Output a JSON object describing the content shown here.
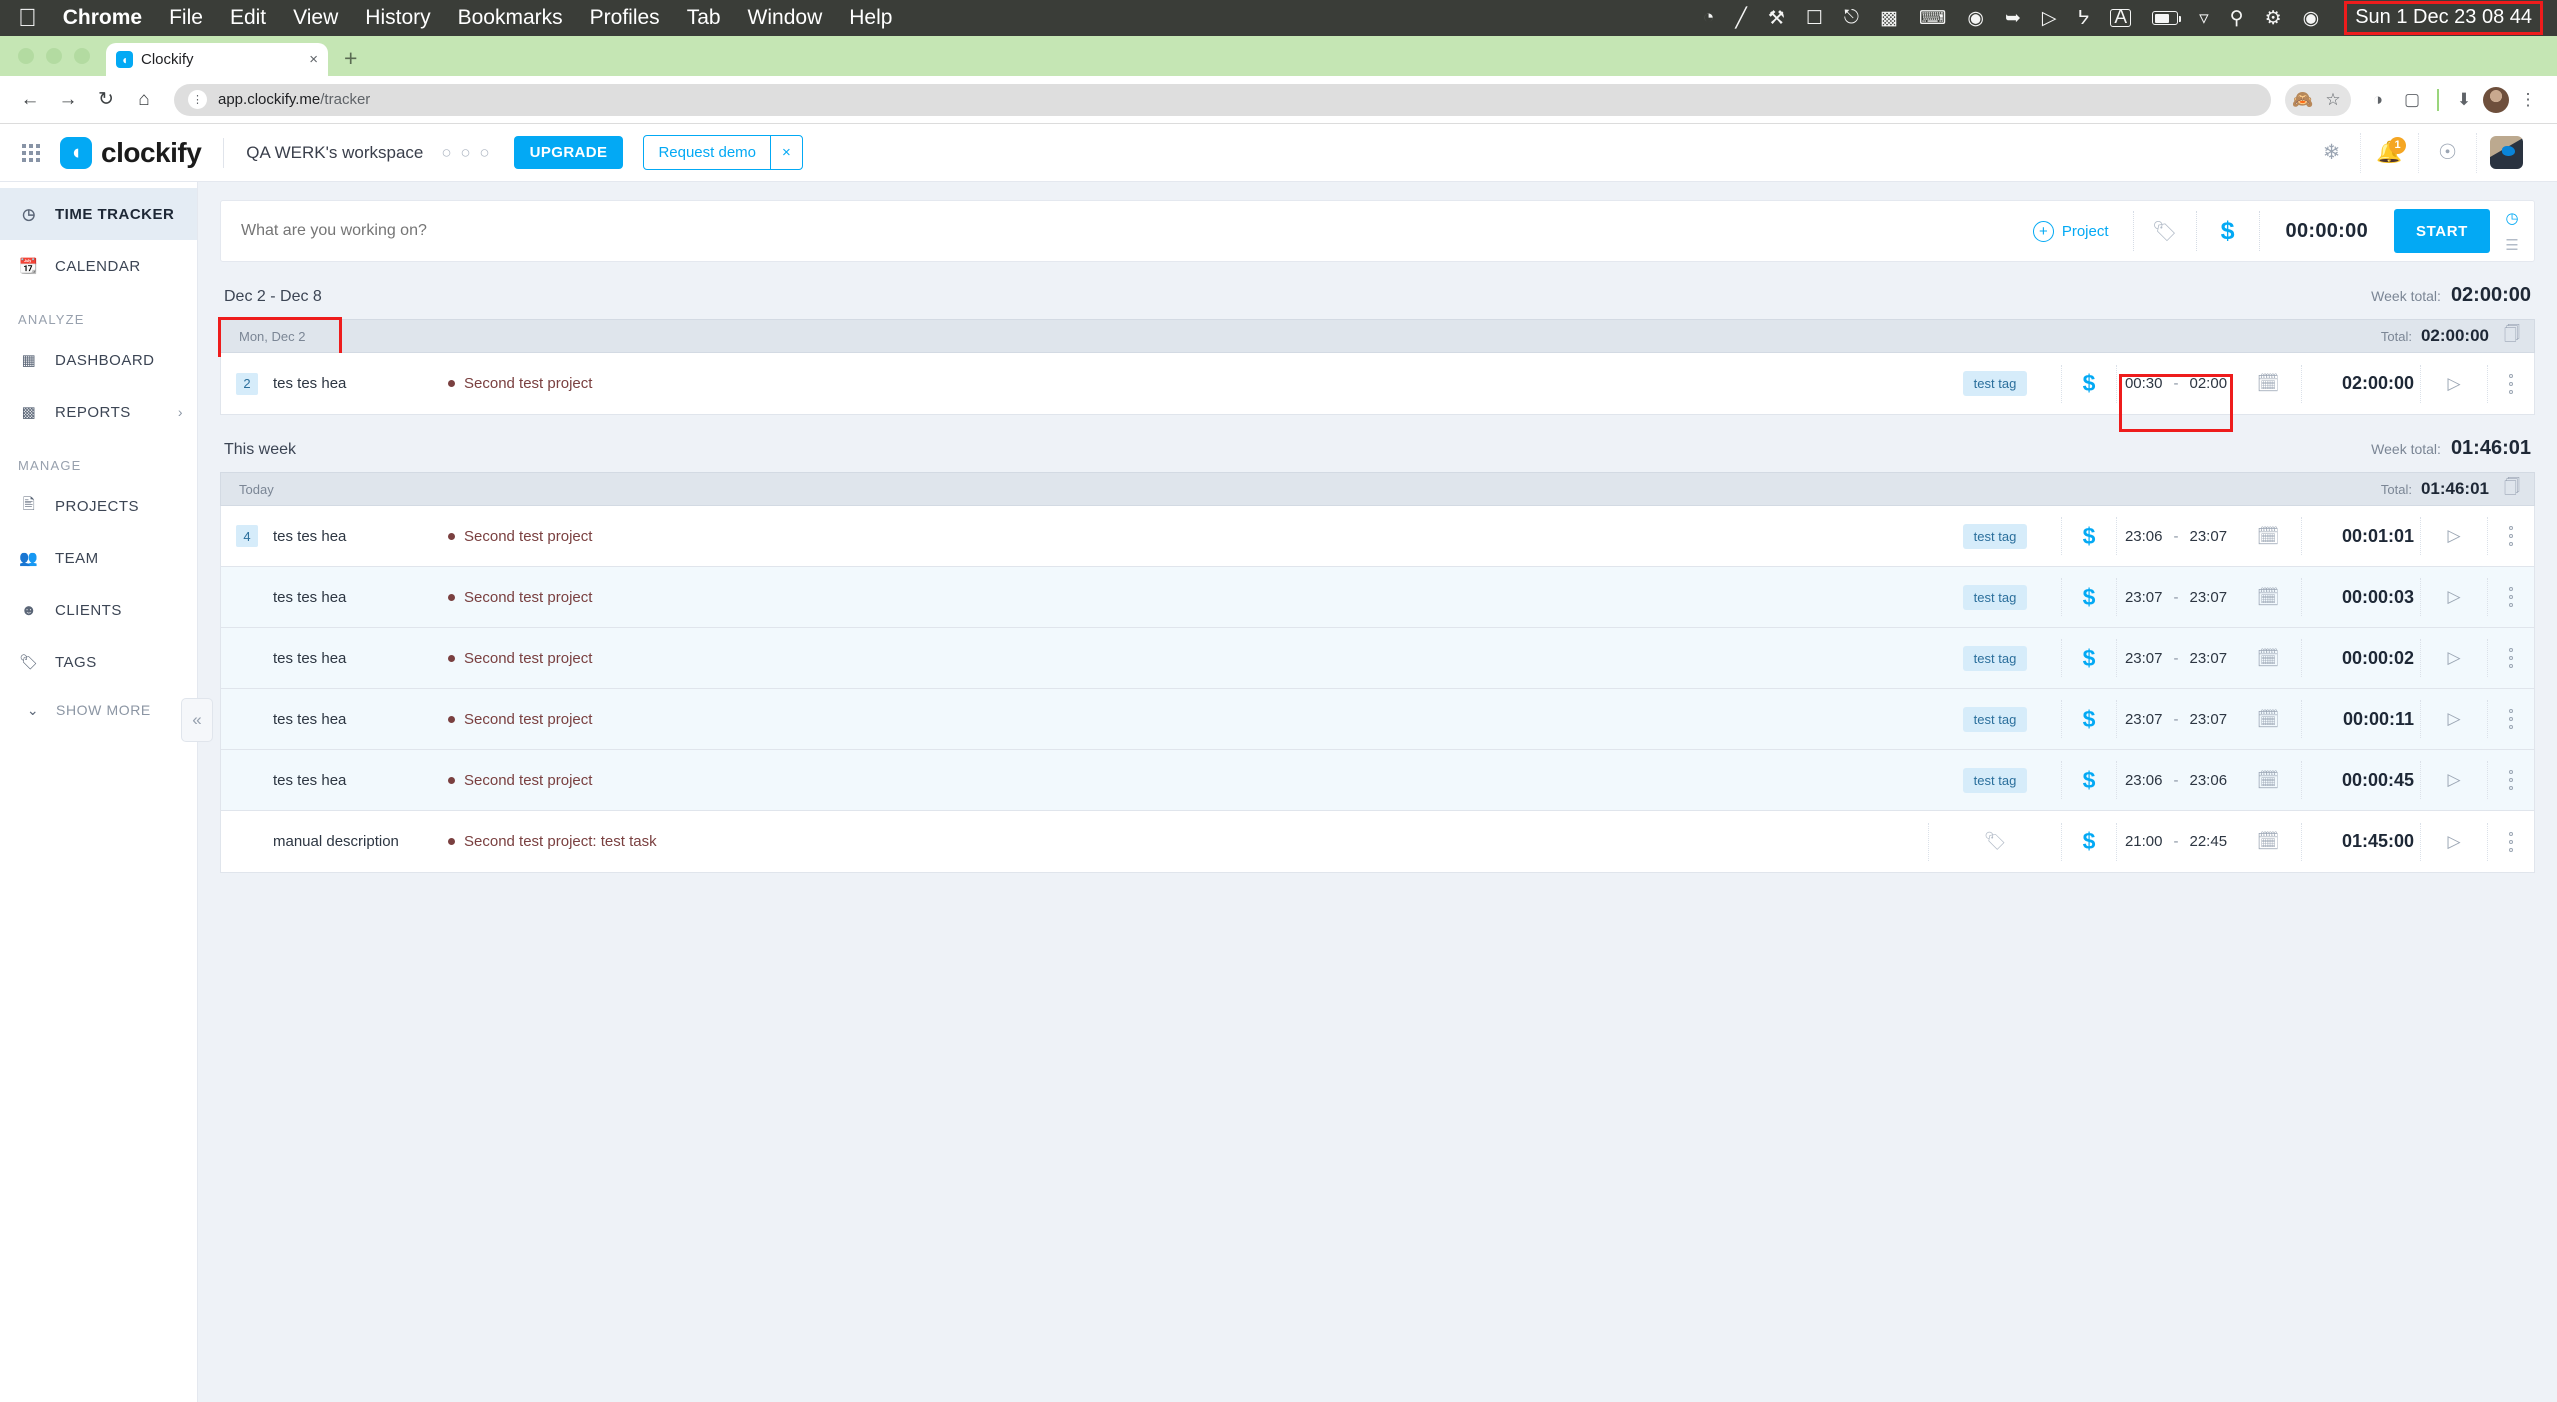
{
  "os_bar": {
    "apple_logo": "apple-icon",
    "menus": [
      "Chrome",
      "File",
      "Edit",
      "View",
      "History",
      "Bookmarks",
      "Profiles",
      "Tab",
      "Window",
      "Help"
    ],
    "status_icons": [
      "screen-record-icon",
      "pencil-icon",
      "contacts-sync-icon",
      "outlook-icon",
      "headphones-icon",
      "stage-manager-icon",
      "keyboard-icon",
      "bitwarden-icon",
      "shield-icon",
      "play-circle-icon",
      "bluetooth-icon",
      "input-source-a-icon",
      "battery-charging-icon",
      "wifi-icon",
      "spotlight-search-icon",
      "control-center-icon",
      "siri-icon"
    ],
    "clock": "Sun 1 Dec  23 08 44",
    "clock_highlight_color": "#ee1c1c"
  },
  "browser": {
    "tab": {
      "title": "Clockify",
      "favicon": "clockify-favicon",
      "close": "×"
    },
    "new_tab": "+",
    "nav": {
      "back": "←",
      "forward": "→",
      "reload": "↻",
      "home": "⌂"
    },
    "omnibox": {
      "url_host": "app.clockify.me",
      "url_path": "/tracker",
      "site_info": "site-settings-icon"
    },
    "toolbar_icons": [
      "eye-off-icon",
      "bookmark-star-icon",
      "clockify-extension-icon",
      "extensions-puzzle-icon",
      "downloads-icon",
      "profile-avatar",
      "chrome-menu-icon"
    ]
  },
  "app_header": {
    "apps_grid": "apps-grid-icon",
    "brand": "clockify",
    "workspace": "QA WERK's workspace",
    "workspace_menu": "○ ○ ○",
    "upgrade_label": "UPGRADE",
    "demo_label": "Request demo",
    "demo_close": "×",
    "right_icons": [
      "integrations-icon",
      "notifications-bell-icon",
      "help-icon",
      "user-avatar"
    ],
    "notification_count": "1",
    "accent_color": "#03a9f4"
  },
  "sidebar": {
    "items": [
      {
        "label": "TIME TRACKER",
        "icon": "clock-icon",
        "active": true
      },
      {
        "label": "CALENDAR",
        "icon": "calendar-icon",
        "active": false
      }
    ],
    "group_analyze": "ANALYZE",
    "analyze_items": [
      {
        "label": "DASHBOARD",
        "icon": "dashboard-grid-icon",
        "chevron": ""
      },
      {
        "label": "REPORTS",
        "icon": "bar-chart-icon",
        "chevron": "›"
      }
    ],
    "group_manage": "MANAGE",
    "manage_items": [
      {
        "label": "PROJECTS",
        "icon": "document-icon"
      },
      {
        "label": "TEAM",
        "icon": "people-icon"
      },
      {
        "label": "CLIENTS",
        "icon": "person-circle-icon"
      },
      {
        "label": "TAGS",
        "icon": "tag-icon"
      }
    ],
    "show_more": "SHOW MORE",
    "show_more_chevron": "⌄",
    "collapse": "«"
  },
  "timer_bar": {
    "placeholder": "What are you working on?",
    "project_label": "Project",
    "project_icon": "plus-circle-icon",
    "tag_icon": "tag-icon",
    "billable_icon": "dollar-icon",
    "duration": "00:00:00",
    "start_label": "START",
    "mode_timer_icon": "timer-mode-icon",
    "mode_manual_icon": "manual-mode-icon"
  },
  "sections": [
    {
      "name": "week-dec2",
      "range_label": "Dec 2 - Dec 8",
      "week_total_label": "Week total:",
      "week_total": "02:00:00",
      "day_label": "Mon, Dec 2",
      "day_total_label": "Total:",
      "day_total": "02:00:00",
      "day_highlighted": true,
      "entries": [
        {
          "count": "2",
          "description": "tes tes hea",
          "project": "Second test project",
          "tag": "test tag",
          "billable": "$",
          "start": "00:30",
          "end": "02:00",
          "duration": "02:00:00",
          "times_highlighted": true,
          "alt_row": false
        }
      ]
    },
    {
      "name": "this-week",
      "range_label": "This week",
      "week_total_label": "Week total:",
      "week_total": "01:46:01",
      "day_label": "Today",
      "day_total_label": "Total:",
      "day_total": "01:46:01",
      "day_highlighted": false,
      "entries": [
        {
          "count": "4",
          "description": "tes tes hea",
          "project": "Second test project",
          "tag": "test tag",
          "billable": "$",
          "start": "23:06",
          "end": "23:07",
          "duration": "00:01:01",
          "times_highlighted": false,
          "alt_row": false
        },
        {
          "count": "",
          "description": "tes tes hea",
          "project": "Second test project",
          "tag": "test tag",
          "billable": "$",
          "start": "23:07",
          "end": "23:07",
          "duration": "00:00:03",
          "times_highlighted": false,
          "alt_row": true
        },
        {
          "count": "",
          "description": "tes tes hea",
          "project": "Second test project",
          "tag": "test tag",
          "billable": "$",
          "start": "23:07",
          "end": "23:07",
          "duration": "00:00:02",
          "times_highlighted": false,
          "alt_row": true
        },
        {
          "count": "",
          "description": "tes tes hea",
          "project": "Second test project",
          "tag": "test tag",
          "billable": "$",
          "start": "23:07",
          "end": "23:07",
          "duration": "00:00:11",
          "times_highlighted": false,
          "alt_row": true
        },
        {
          "count": "",
          "description": "tes tes hea",
          "project": "Second test project",
          "tag": "test tag",
          "billable": "$",
          "start": "23:06",
          "end": "23:06",
          "duration": "00:00:45",
          "times_highlighted": false,
          "alt_row": true
        },
        {
          "count": "",
          "description": "manual description",
          "project": "Second test project: test task",
          "tag": "",
          "billable": "$",
          "start": "21:00",
          "end": "22:45",
          "duration": "01:45:00",
          "times_highlighted": false,
          "alt_row": false
        }
      ]
    }
  ],
  "colors": {
    "accent": "#03a9f4",
    "project": "#7a4040",
    "tag_bg": "#d6ecfa",
    "highlight": "#ee1c1c",
    "canvas": "#eef2f7"
  }
}
